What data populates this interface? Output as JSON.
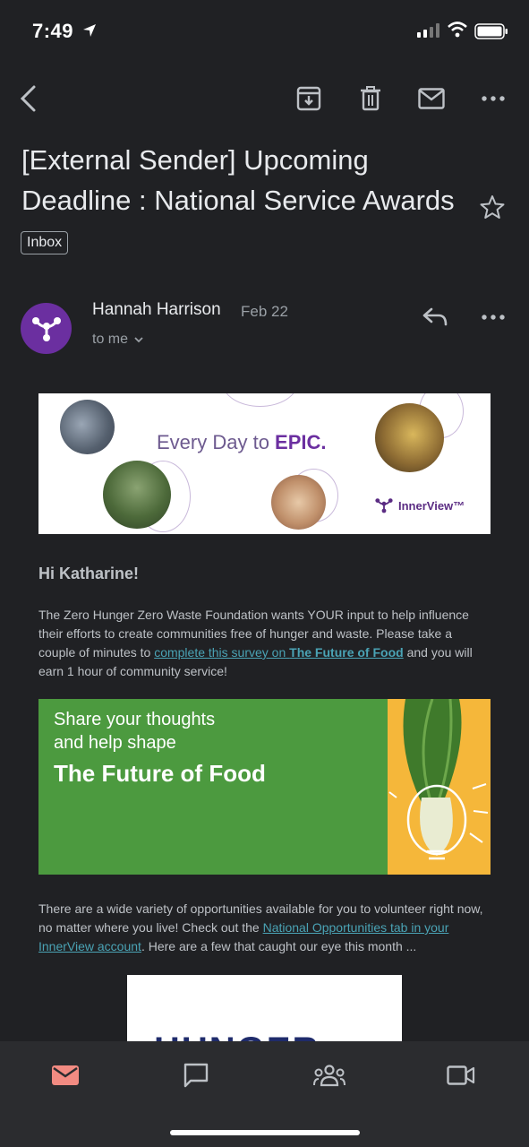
{
  "status_bar": {
    "time": "7:49"
  },
  "email": {
    "subject": "[External Sender] Upcoming Deadline : National Service Awards",
    "label": "Inbox",
    "sender": {
      "name": "Hannah Harrison",
      "date": "Feb 22",
      "recipient": "to me"
    }
  },
  "body": {
    "hero": {
      "tagline_prefix": "Every Day to ",
      "tagline_bold": "EPIC.",
      "logo_text": "InnerView™"
    },
    "greeting": "Hi Katharine!",
    "para1": {
      "text_before": "The Zero Hunger Zero Waste Foundation wants YOUR input to help influence their efforts to create communities free of hunger and waste. Please take a couple of minutes to ",
      "link_text": "complete this survey on ",
      "link_bold": "The Future of Food",
      "text_after": " and you will earn 1 hour of community service!"
    },
    "banner": {
      "line1": "Share your thoughts",
      "line2": "and help shape",
      "line3": "The Future of Food"
    },
    "para2": {
      "text_before": "There are a wide variety of opportunities available for you to volunteer right now, no matter where you live! Check out the ",
      "link_text": "National Opportunities tab in your InnerView account",
      "text_after": ". Here are a few that caught our eye this month ..."
    },
    "partial_image_text": "HUNGER"
  },
  "colors": {
    "background": "#202124",
    "bottom_nav": "#2b2c2f",
    "mail_active": "#f28b82",
    "avatar": "#6b2fa0",
    "link": "#4aa3b5",
    "banner_green": "#4c9a3f"
  },
  "icons": [
    "back-arrow-icon",
    "archive-icon",
    "delete-icon",
    "mark-unread-icon",
    "more-icon",
    "star-icon",
    "reply-icon",
    "mail-icon",
    "chat-icon",
    "spaces-icon",
    "meet-icon"
  ]
}
